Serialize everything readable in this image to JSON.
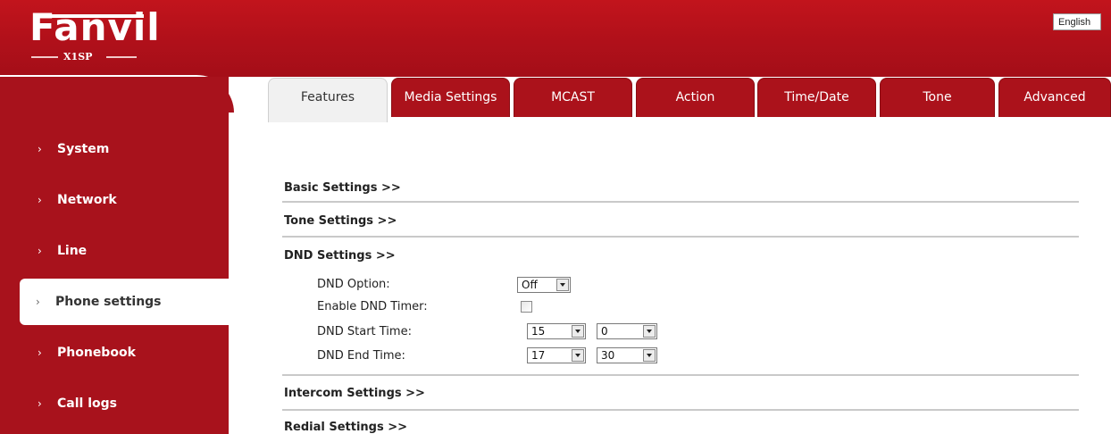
{
  "header": {
    "brand": "Fanvil",
    "model": "X1SP",
    "language": "English"
  },
  "sidebar": {
    "items": [
      {
        "label": "System"
      },
      {
        "label": "Network"
      },
      {
        "label": "Line"
      },
      {
        "label": "Phone settings",
        "active": true
      },
      {
        "label": "Phonebook"
      },
      {
        "label": "Call logs"
      }
    ]
  },
  "tabs": [
    {
      "label": "Features",
      "active": true
    },
    {
      "label": "Media Settings"
    },
    {
      "label": "MCAST"
    },
    {
      "label": "Action"
    },
    {
      "label": "Time/Date"
    },
    {
      "label": "Tone"
    },
    {
      "label": "Advanced"
    }
  ],
  "sections": {
    "basic": "Basic Settings >>",
    "tone": "Tone Settings >>",
    "dnd": "DND Settings >>",
    "intercom": "Intercom Settings >>",
    "redial": "Redial Settings >>"
  },
  "dnd": {
    "option_label": "DND Option:",
    "option_value": "Off",
    "timer_label": "Enable DND Timer:",
    "timer_checked": false,
    "start_label": "DND Start Time:",
    "start_hour": "15",
    "start_min": "0",
    "end_label": "DND End Time:",
    "end_hour": "17",
    "end_min": "30"
  },
  "colors": {
    "brand_red": "#b0101a",
    "sidebar_red": "#a8121c"
  }
}
